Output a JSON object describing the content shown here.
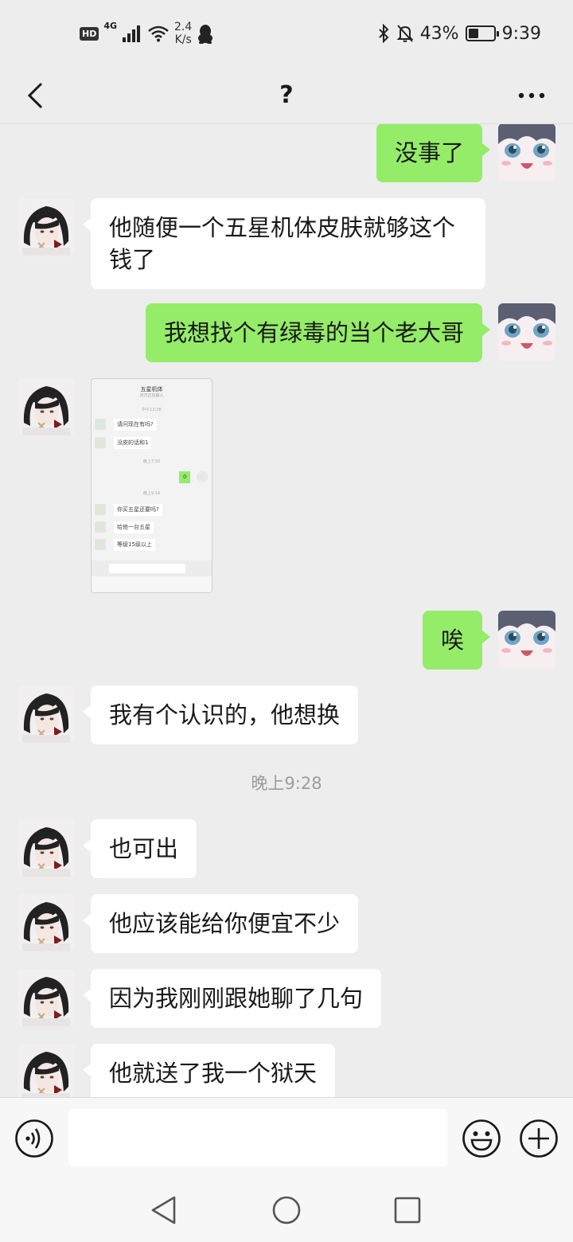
{
  "status_bar": {
    "hd": "HD",
    "network": "4G",
    "speed_value": "2.4",
    "speed_unit": "K/s",
    "battery": "43%",
    "battery_level": 0.43,
    "time": "9:39"
  },
  "header": {
    "title": "?"
  },
  "messages": [
    {
      "side": "right",
      "text": "没事了"
    },
    {
      "side": "left",
      "text": "他随便一个五星机体皮肤就够这个钱了"
    },
    {
      "side": "right",
      "text": "我想找个有绿毒的当个老大哥"
    },
    {
      "side": "left",
      "type": "image"
    },
    {
      "side": "right",
      "text": "唉"
    },
    {
      "side": "left",
      "text": "我有个认识的，他想换"
    },
    {
      "type": "time",
      "text": "晚上9:28"
    },
    {
      "side": "left",
      "text": "也可出"
    },
    {
      "side": "left",
      "text": "他应该能给你便宜不少"
    },
    {
      "side": "left",
      "text": "因为我刚刚跟她聊了几句"
    },
    {
      "side": "left",
      "text": "他就送了我一个狱天"
    }
  ],
  "image_message": {
    "title": "五星机体",
    "subtitle": "对方正在输入",
    "times": [
      "中午12:38",
      "晚上7:50",
      "晚上9:14"
    ],
    "bubbles": [
      "请问现在有吗?",
      "没皮的话和1",
      "0",
      "你买五星还要吗?",
      "给他一台五星",
      "等级15级以上"
    ]
  },
  "input_bar": {
    "placeholder": ""
  },
  "icons": {
    "back": "chevron-left-icon",
    "more": "more-dots-icon",
    "voice": "voice-icon",
    "emoji": "emoji-icon",
    "plus": "plus-icon",
    "nav_back": "triangle-back-icon",
    "nav_home": "circle-home-icon",
    "nav_recent": "square-recent-icon"
  },
  "colors": {
    "background": "#ededed",
    "bubble_self": "#95ec69",
    "bubble_other": "#ffffff",
    "time_text": "#9c9c9c"
  }
}
